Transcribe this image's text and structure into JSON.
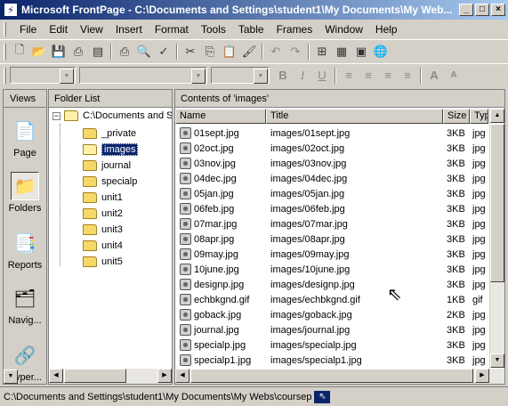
{
  "window": {
    "title": "Microsoft FrontPage - C:\\Documents and Settings\\student1\\My Documents\\My Web...",
    "app_icon": "frontpage-icon",
    "controls": [
      "minimize",
      "maximize",
      "close"
    ]
  },
  "menu": [
    {
      "label": "File"
    },
    {
      "label": "Edit"
    },
    {
      "label": "View"
    },
    {
      "label": "Insert"
    },
    {
      "label": "Format"
    },
    {
      "label": "Tools"
    },
    {
      "label": "Table"
    },
    {
      "label": "Frames"
    },
    {
      "label": "Window"
    },
    {
      "label": "Help"
    }
  ],
  "toolbar_formatting": {
    "bold": "B",
    "italic": "I",
    "underline": "U"
  },
  "views": {
    "header": "Views",
    "items": [
      {
        "label": "Page",
        "icon": "page-icon"
      },
      {
        "label": "Folders",
        "icon": "folders-icon",
        "selected": true
      },
      {
        "label": "Reports",
        "icon": "reports-icon"
      },
      {
        "label": "Navig...",
        "icon": "navigation-icon"
      },
      {
        "label": "Hyper...",
        "icon": "hyperlinks-icon"
      }
    ]
  },
  "folder_list": {
    "header": "Folder List",
    "root": "C:\\Documents and S",
    "folders": [
      {
        "label": "_private"
      },
      {
        "label": "images",
        "selected": true
      },
      {
        "label": "journal"
      },
      {
        "label": "specialp"
      },
      {
        "label": "unit1"
      },
      {
        "label": "unit2"
      },
      {
        "label": "unit3"
      },
      {
        "label": "unit4"
      },
      {
        "label": "unit5"
      }
    ]
  },
  "contents": {
    "header": "Contents of 'images'",
    "columns": {
      "name": "Name",
      "title": "Title",
      "size": "Size",
      "type": "Typ"
    },
    "files": [
      {
        "name": "01sept.jpg",
        "title": "images/01sept.jpg",
        "size": "3KB",
        "type": "jpg"
      },
      {
        "name": "02oct.jpg",
        "title": "images/02oct.jpg",
        "size": "3KB",
        "type": "jpg"
      },
      {
        "name": "03nov.jpg",
        "title": "images/03nov.jpg",
        "size": "3KB",
        "type": "jpg"
      },
      {
        "name": "04dec.jpg",
        "title": "images/04dec.jpg",
        "size": "3KB",
        "type": "jpg"
      },
      {
        "name": "05jan.jpg",
        "title": "images/05jan.jpg",
        "size": "3KB",
        "type": "jpg"
      },
      {
        "name": "06feb.jpg",
        "title": "images/06feb.jpg",
        "size": "3KB",
        "type": "jpg"
      },
      {
        "name": "07mar.jpg",
        "title": "images/07mar.jpg",
        "size": "3KB",
        "type": "jpg"
      },
      {
        "name": "08apr.jpg",
        "title": "images/08apr.jpg",
        "size": "3KB",
        "type": "jpg"
      },
      {
        "name": "09may.jpg",
        "title": "images/09may.jpg",
        "size": "3KB",
        "type": "jpg"
      },
      {
        "name": "10june.jpg",
        "title": "images/10june.jpg",
        "size": "3KB",
        "type": "jpg"
      },
      {
        "name": "designp.jpg",
        "title": "images/designp.jpg",
        "size": "3KB",
        "type": "jpg"
      },
      {
        "name": "echbkgnd.gif",
        "title": "images/echbkgnd.gif",
        "size": "1KB",
        "type": "gif"
      },
      {
        "name": "goback.jpg",
        "title": "images/goback.jpg",
        "size": "2KB",
        "type": "jpg"
      },
      {
        "name": "journal.jpg",
        "title": "images/journal.jpg",
        "size": "3KB",
        "type": "jpg"
      },
      {
        "name": "specialp.jpg",
        "title": "images/specialp.jpg",
        "size": "3KB",
        "type": "jpg"
      },
      {
        "name": "specialp1.jpg",
        "title": "images/specialp1.jpg",
        "size": "3KB",
        "type": "jpg"
      }
    ]
  },
  "status": {
    "text": "C:\\Documents and Settings\\student1\\My Documents\\My Webs\\coursep"
  }
}
